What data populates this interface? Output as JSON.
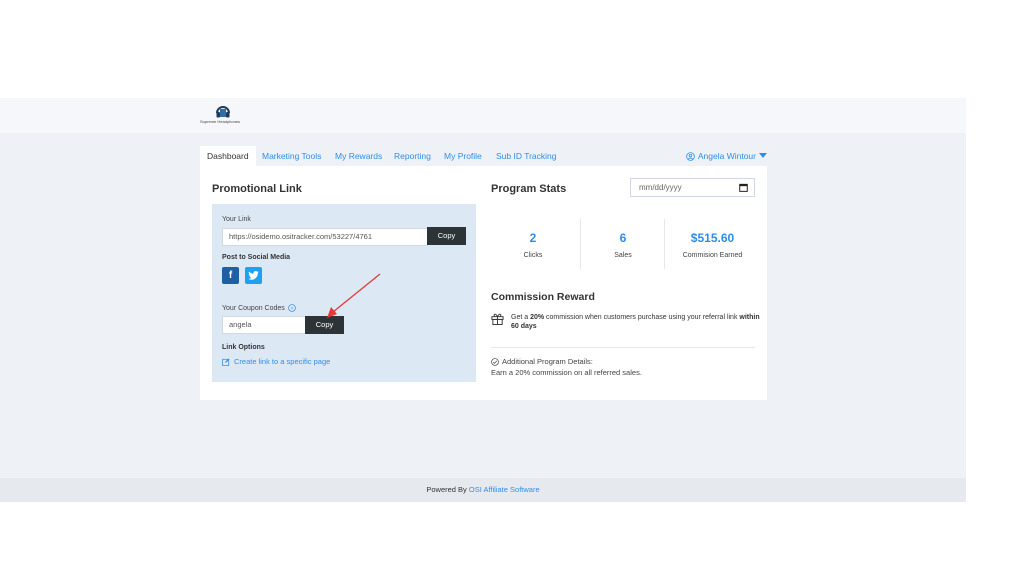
{
  "header": {
    "brand": "Supreme Headphones"
  },
  "tabs": [
    {
      "label": "Dashboard"
    },
    {
      "label": "Marketing Tools"
    },
    {
      "label": "My Rewards"
    },
    {
      "label": "Reporting"
    },
    {
      "label": "My Profile"
    },
    {
      "label": "Sub ID Tracking"
    }
  ],
  "user": {
    "name": "Angela Wintour"
  },
  "promo": {
    "title": "Promotional Link",
    "your_link_label": "Your Link",
    "link_value": "https://osidemo.ositracker.com/53227/4761",
    "copy_label": "Copy",
    "social_label": "Post to Social Media",
    "coupon_label": "Your Coupon Codes",
    "coupon_value": "angela",
    "coupon_copy_label": "Copy",
    "link_options_label": "Link Options",
    "create_link_label": "Create link to a specific page"
  },
  "stats": {
    "title": "Program Stats",
    "date_placeholder": "mm/dd/yyyy",
    "items": [
      {
        "value": "2",
        "label": "Clicks"
      },
      {
        "value": "6",
        "label": "Sales"
      },
      {
        "value": "$515.60",
        "label": "Commision Earned"
      }
    ]
  },
  "reward": {
    "title": "Commission Reward",
    "text_1": "Get a ",
    "pct": "20%",
    "text_2": " commission when customers purchase using your referral link ",
    "period": "within 60 days",
    "details_title": "Additional Program Details:",
    "details_text": "Earn a 20% commission on all referred sales."
  },
  "footer": {
    "prefix": "Powered By ",
    "link": "OSI Affiliate Software"
  },
  "colors": {
    "accent": "#2f8dea",
    "dark_button": "#2d3438",
    "annotation_arrow": "#e53935"
  }
}
